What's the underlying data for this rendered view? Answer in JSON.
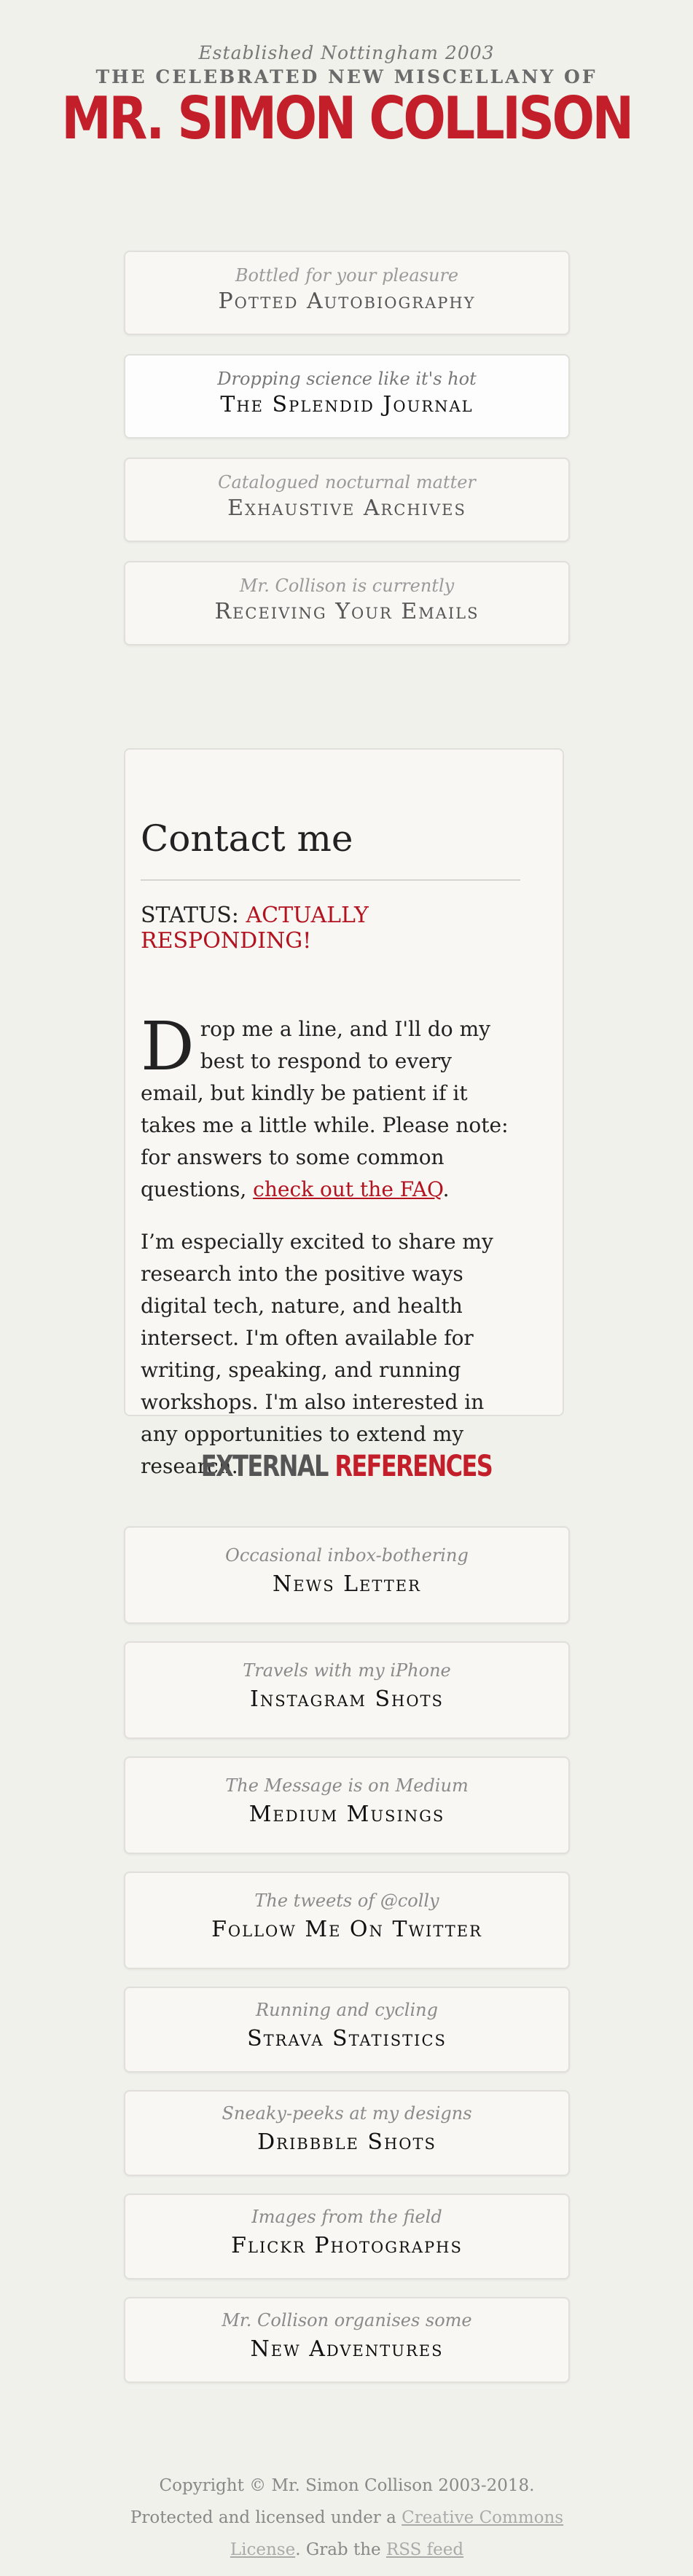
{
  "masthead": {
    "established": "Established Nottingham 2003",
    "celebrated": "THE CELEBRATED NEW MISCELLANY OF",
    "name": "MR. SIMON COLLISON"
  },
  "nav": [
    {
      "sub": "Bottled for your pleasure",
      "title": "Potted Autobiography"
    },
    {
      "sub": "Dropping science like it's hot",
      "title": "The Splendid Journal"
    },
    {
      "sub": "Catalogued nocturnal matter",
      "title": "Exhaustive Archives"
    },
    {
      "sub": "Mr. Collison is currently",
      "title": "Receiving Your Emails"
    }
  ],
  "contact": {
    "heading": "Contact me",
    "status_label": "STATUS:",
    "status_value": "ACTUALLY RESPONDING!",
    "dropcap": "D",
    "para1_text": "rop me a line, and I'll do my best to respond to every email, but kindly be patient if it takes me a little while. Please note: for answers to some common questions, ",
    "para1_link": "check out the FAQ",
    "para1_end": ".",
    "para2": "I’m especially excited to share my research into the positive ways digital tech, nature, and health intersect. I'm often available for writing, speaking, and running workshops. I'm also interested in any opportunities to extend my research."
  },
  "external": {
    "heading_a": "EXTERNAL",
    "heading_b": "REFERENCES",
    "items": [
      {
        "sub": "Occasional inbox-bothering",
        "title": "News Letter"
      },
      {
        "sub": "Travels with my iPhone",
        "title": "Instagram Shots"
      },
      {
        "sub": "The Message is on Medium",
        "title": "Medium Musings"
      },
      {
        "sub": "The tweets of @colly",
        "title": "Follow Me On Twitter"
      },
      {
        "sub": "Running and cycling",
        "title": "Strava Statistics"
      },
      {
        "sub": "Sneaky-peeks at my designs",
        "title": "Dribbble Shots"
      },
      {
        "sub": "Images from the field",
        "title": "Flickr Photographs"
      },
      {
        "sub": "Mr. Collison organises some",
        "title": "New Adventures"
      }
    ]
  },
  "footer": {
    "text1": "Copyright © Mr. Simon Collison 2003-2018. Protected and licensed under a ",
    "license_link": "Creative Commons License",
    "text2": ". Grab the ",
    "rss_link": "RSS feed"
  },
  "colors": {
    "background": "#f1f1ec",
    "brand_red": "#c21f2a",
    "link_red": "#b3121f"
  }
}
